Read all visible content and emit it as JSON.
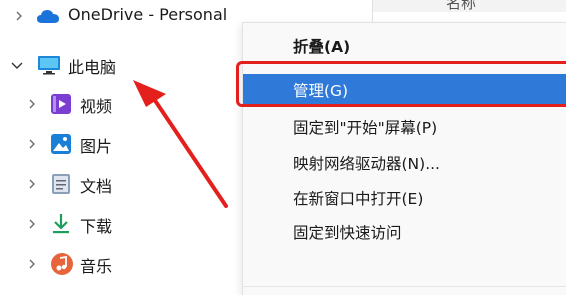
{
  "nav": {
    "onedrive": "OneDrive - Personal",
    "this_pc": "此电脑",
    "children": [
      {
        "label": "视频",
        "icon": "video-folder-icon"
      },
      {
        "label": "图片",
        "icon": "pictures-folder-icon"
      },
      {
        "label": "文档",
        "icon": "documents-folder-icon"
      },
      {
        "label": "下载",
        "icon": "downloads-folder-icon"
      },
      {
        "label": "音乐",
        "icon": "music-folder-icon"
      }
    ]
  },
  "header": {
    "column_name": "名称"
  },
  "context_menu": {
    "items": [
      {
        "label": "折叠(A)"
      },
      {
        "label": "管理(G)"
      },
      {
        "label": "固定到\"开始\"屏幕(P)"
      },
      {
        "label": "映射网络驱动器(N)..."
      },
      {
        "label": "在新窗口中打开(E)"
      },
      {
        "label": "固定到快速访问"
      }
    ]
  },
  "colors": {
    "highlight": "#2f7ad8",
    "annotation_red": "#e3201b",
    "onedrive_blue": "#1a73d9"
  }
}
